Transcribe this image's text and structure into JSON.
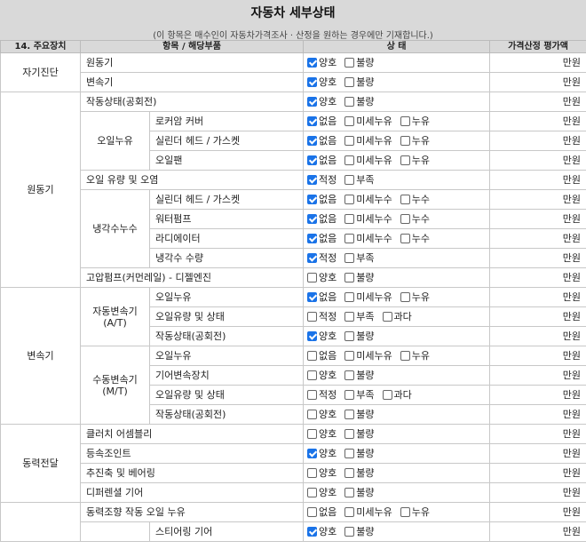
{
  "title": "자동차 세부상태",
  "subtitle": "(이 항목은 매수인이 자동차가격조사 · 산정을 원하는 경우에만 기재합니다.)",
  "headers": {
    "device": "14. 주요장치",
    "item": "항목 / 해당부품",
    "status": "상 태",
    "price": "가격산정 평가액"
  },
  "unit": "만원",
  "rows": [
    {
      "cat": "자기진단",
      "catSpan": 2,
      "item": "원동기",
      "opts": [
        [
          "양호",
          true
        ],
        [
          "불량",
          false
        ]
      ]
    },
    {
      "item": "변속기",
      "opts": [
        [
          "양호",
          true
        ],
        [
          "불량",
          false
        ]
      ]
    },
    {
      "cat": "원동기",
      "catSpan": 10,
      "item": "작동상태(공회전)",
      "opts": [
        [
          "양호",
          true
        ],
        [
          "불량",
          false
        ]
      ]
    },
    {
      "sub": "오일누유",
      "subSpan": 3,
      "item": "로커암 커버",
      "opts": [
        [
          "없음",
          true
        ],
        [
          "미세누유",
          false
        ],
        [
          "누유",
          false
        ]
      ]
    },
    {
      "item": "실린더 헤드 / 가스켓",
      "opts": [
        [
          "없음",
          true
        ],
        [
          "미세누유",
          false
        ],
        [
          "누유",
          false
        ]
      ]
    },
    {
      "item": "오일팬",
      "opts": [
        [
          "없음",
          true
        ],
        [
          "미세누유",
          false
        ],
        [
          "누유",
          false
        ]
      ]
    },
    {
      "item": "오일 유량 및 오염",
      "opts": [
        [
          "적정",
          true
        ],
        [
          "부족",
          false
        ]
      ]
    },
    {
      "sub": "냉각수누수",
      "subSpan": 4,
      "item": "실린더 헤드 / 가스켓",
      "opts": [
        [
          "없음",
          true
        ],
        [
          "미세누수",
          false
        ],
        [
          "누수",
          false
        ]
      ]
    },
    {
      "item": "워터펌프",
      "opts": [
        [
          "없음",
          true
        ],
        [
          "미세누수",
          false
        ],
        [
          "누수",
          false
        ]
      ]
    },
    {
      "item": "라디에이터",
      "opts": [
        [
          "없음",
          true
        ],
        [
          "미세누수",
          false
        ],
        [
          "누수",
          false
        ]
      ]
    },
    {
      "item": "냉각수 수량",
      "opts": [
        [
          "적정",
          true
        ],
        [
          "부족",
          false
        ]
      ]
    },
    {
      "item": "고압펌프(커먼레일) - 디젤엔진",
      "opts": [
        [
          "양호",
          false
        ],
        [
          "불량",
          false
        ]
      ]
    },
    {
      "cat": "변속기",
      "catSpan": 7,
      "sub": "자동변속기\n(A/T)",
      "subSpan": 3,
      "item": "오일누유",
      "opts": [
        [
          "없음",
          true
        ],
        [
          "미세누유",
          false
        ],
        [
          "누유",
          false
        ]
      ]
    },
    {
      "item": "오일유량 및 상태",
      "opts": [
        [
          "적정",
          false
        ],
        [
          "부족",
          false
        ],
        [
          "과다",
          false
        ]
      ]
    },
    {
      "item": "작동상태(공회전)",
      "opts": [
        [
          "양호",
          true
        ],
        [
          "불량",
          false
        ]
      ]
    },
    {
      "sub": "수동변속기\n(M/T)",
      "subSpan": 4,
      "item": "오일누유",
      "opts": [
        [
          "없음",
          false
        ],
        [
          "미세누유",
          false
        ],
        [
          "누유",
          false
        ]
      ]
    },
    {
      "item": "기어변속장치",
      "opts": [
        [
          "양호",
          false
        ],
        [
          "불량",
          false
        ]
      ]
    },
    {
      "item": "오일유량 및 상태",
      "opts": [
        [
          "적정",
          false
        ],
        [
          "부족",
          false
        ],
        [
          "과다",
          false
        ]
      ]
    },
    {
      "item": "작동상태(공회전)",
      "opts": [
        [
          "양호",
          false
        ],
        [
          "불량",
          false
        ]
      ]
    },
    {
      "cat": "동력전달",
      "catSpan": 4,
      "item": "클러치 어셈블리",
      "opts": [
        [
          "양호",
          false
        ],
        [
          "불량",
          false
        ]
      ]
    },
    {
      "item": "등속조인트",
      "opts": [
        [
          "양호",
          true
        ],
        [
          "불량",
          false
        ]
      ]
    },
    {
      "item": "추진축 및 베어링",
      "opts": [
        [
          "양호",
          false
        ],
        [
          "불량",
          false
        ]
      ]
    },
    {
      "item": "디퍼렌셜 기어",
      "opts": [
        [
          "양호",
          false
        ],
        [
          "불량",
          false
        ]
      ]
    },
    {
      "cat": "",
      "catSpan": 2,
      "item": "동력조향 작동 오일 누유",
      "opts": [
        [
          "없음",
          false
        ],
        [
          "미세누유",
          false
        ],
        [
          "누유",
          false
        ]
      ]
    },
    {
      "item": "스티어링 기어",
      "indent": true,
      "opts": [
        [
          "양호",
          true
        ],
        [
          "불량",
          false
        ]
      ]
    }
  ]
}
